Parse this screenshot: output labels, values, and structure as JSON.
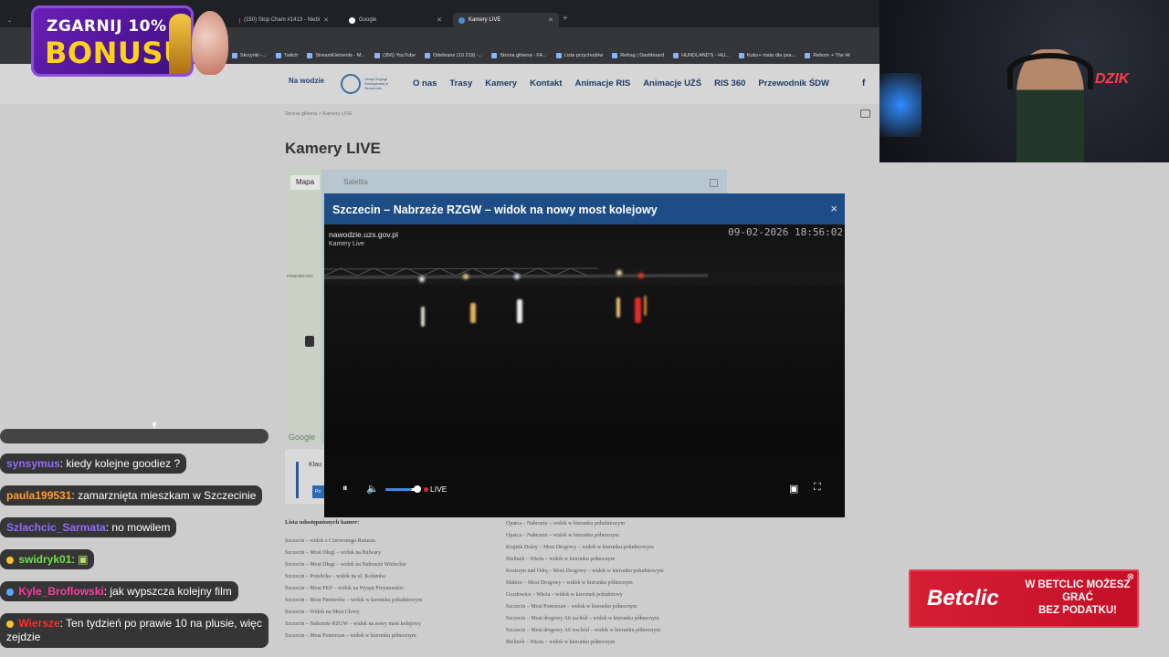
{
  "browser": {
    "tabs": [
      {
        "label": "(150) Stop Cham #1413 - Niebi"
      },
      {
        "label": "Google"
      },
      {
        "label": "Kamery LIVE"
      }
    ],
    "bookmarks": [
      "Skrzynki -...",
      "Twitch",
      "StreamElements - M...",
      "(356) YouTube",
      "Odebrane (10 219) -...",
      "Strona główna - FA...",
      "Lista przychodów",
      "Refrag | Dashboard",
      "HUNDLAND'S - HU...",
      "Kuko+ mata dla psa...",
      "Reborn + The Hi"
    ]
  },
  "promo": {
    "line1": "ZGARNIJ 10%",
    "line2": "BONUSU"
  },
  "site": {
    "logo_na": "Na wodzie",
    "logo_uzs": "Urząd Żeglugi Śródlądowej w Szczecinie",
    "menu": [
      "O nas",
      "Trasy",
      "Kamery",
      "Kontakt",
      "Animacje RIS",
      "Animacje UŻŚ",
      "RIS 360",
      "Przewodnik ŚDW"
    ],
    "social": "f",
    "breadcrumb": "Strona główna  >  Kamery LIVE",
    "title": "Kamery LIVE",
    "map": {
      "tab_map": "Mapa",
      "tab_sat": "Satelita",
      "place": "POMORZANY",
      "google": "Google"
    },
    "card": {
      "text": "Klau",
      "button": "Po"
    },
    "camlist_title": "Lista udostępnionych kamer:",
    "cams_left": [
      "Szczecin – widok z Czerwonego Ratusza",
      "Szczecin – Most Długi – widok na Bulwary",
      "Szczecin – Most Długi – widok na Nabrzeże Wieleckie",
      "Szczecin – Potulicka – widok na ul. Kolumba",
      "Szczecin – Most PKP – widok na Wyspę Przymorskie",
      "Szczecin – Most Pionierów – widok w kierunku południowym",
      "Szczecin – Widok na Most Cłowy",
      "Szczecin – Nabrzeże RZGW – widok na nowy most kolejowy",
      "Szczecin – Most Pomorzan – widok w kierunku północnym"
    ],
    "cams_right": [
      "Opatca – Nabrzeże – widok w kierunku południowym",
      "Opatca – Nabrzeże – widok w kierunku północnym",
      "Krajnik Dolny – Most Drogowy – widok w kierunku południowym",
      "Bielinek – Wieża – widok w kierunku północnym",
      "Kostrzyn nad Odrą – Most Drogowy – widok w kierunku południowym",
      "Słubice – Most Drogowy – widok w kierunku północnym",
      "Gozdowice – Wieża – widok w kierunek południowy",
      "Szczecin – Most Pomorzan – widok w kierunku północnym",
      "Szczecin – Most drogowy A6 zachód – widok w kierunku północnym",
      "Szczecin – Most drogowy A6 wschód – widok w kierunku północnym",
      "Bielinek – Wieża – widok w kierunku północnym"
    ]
  },
  "modal": {
    "title": "Szczecin – Nabrzeże RZGW – widok na nowy most kolejowy",
    "close": "×",
    "watermark_site": "nawodzie.uzs.gov.pl",
    "watermark_sub": "Kamery Live",
    "timestamp": "09-02-2026 18:56:02",
    "live_label": "LIVE",
    "volume": 0.85,
    "icons": {
      "pause": "⏸",
      "volume": "🔈",
      "pip": "▣",
      "fullscreen": "⛶"
    }
  },
  "chat": [
    {
      "user": "synsymus",
      "text": "kiedy kolejne goodiez ?",
      "color": "#8f6cff"
    },
    {
      "user": "paula199531",
      "text": "zamarznięta mieszkam w Szczecinie",
      "color": "#ff9c2b"
    },
    {
      "user": "Szlachcic_Sarmata",
      "text": "no mowilem",
      "color": "#8f6cff"
    },
    {
      "user": "swidryk01",
      "text": "",
      "color": "#6fe04a"
    },
    {
      "user": "Kyle_Broflowski",
      "text": "jak wypszcza kolejny film",
      "color": "#ff3aa8"
    },
    {
      "user": "Wiersze",
      "text": "Ten tydzień po prawie 10 na plusie, więc",
      "text2": "zejdzie",
      "color": "#ff2b2b"
    }
  ],
  "ad": {
    "brand": "Betclic",
    "line1": "W BETCLIC MOŻESZ GRAĆ",
    "line2": "BEZ PODATKU!",
    "close": "⊗"
  }
}
